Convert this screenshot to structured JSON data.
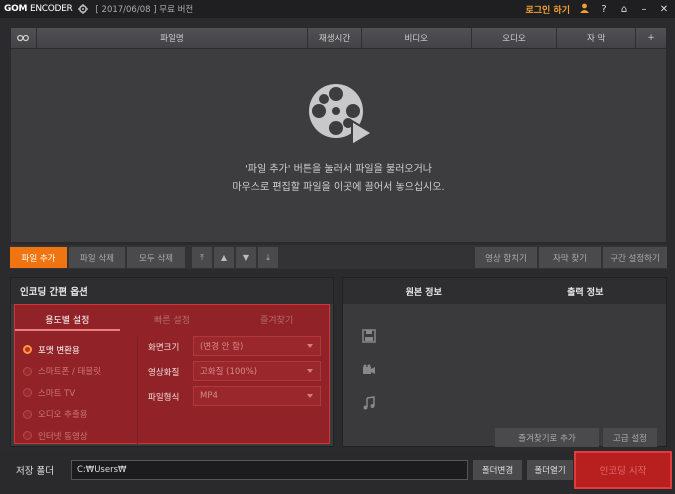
{
  "titlebar": {
    "logo_bold": "GOM",
    "logo_rest": "ENCODER",
    "version": "[ 2017/06/08 ] 무료 버전",
    "login": "로그인 하기",
    "help": "?",
    "home": "⌂",
    "minimize": "–",
    "close": "✕"
  },
  "filelist": {
    "columns": [
      "파일명",
      "재생시간",
      "비디오",
      "오디오",
      "자 막",
      "+"
    ],
    "empty_line1": "'파일 추가' 버튼을 눌러서 파일을 불러오거나",
    "empty_line2": "마우스로 편집할 파일을 이곳에 끌어서 놓으십시오."
  },
  "toolbar": {
    "add_file": "파일 추가",
    "delete_file": "파일 삭제",
    "delete_all": "모두 삭제",
    "move_top": "⤒",
    "move_up": "▲",
    "move_down": "▼",
    "move_bottom": "⤓",
    "video_merge": "영상 합치기",
    "find_subtitle": "자막 찾기",
    "section_settings": "구간 설정하기"
  },
  "options": {
    "title": "인코딩 간편 옵션",
    "tabs": [
      "용도별 설정",
      "빠른 설정",
      "즐겨찾기"
    ],
    "radios": [
      "포맷 변환용",
      "스마트폰 / 태블릿",
      "스마트 TV",
      "오디오 추출용",
      "인터넷 동영상"
    ],
    "selected_index": 0,
    "fields": [
      {
        "label": "화면크기",
        "value": "(변경 안 함)"
      },
      {
        "label": "영상화질",
        "value": "고화질 (100%)"
      },
      {
        "label": "파일형식",
        "value": "MP4"
      }
    ]
  },
  "info": {
    "source_info": "원본 정보",
    "output_info": "출력 정보",
    "add_favorite": "즐겨찾기로 추가",
    "advanced": "고급 설정"
  },
  "save": {
    "label": "저장 폴더",
    "path": "C:₩Users₩",
    "change_folder": "폴더변경",
    "open_folder": "폴더열기",
    "start_encoding": "인코딩 시작"
  }
}
